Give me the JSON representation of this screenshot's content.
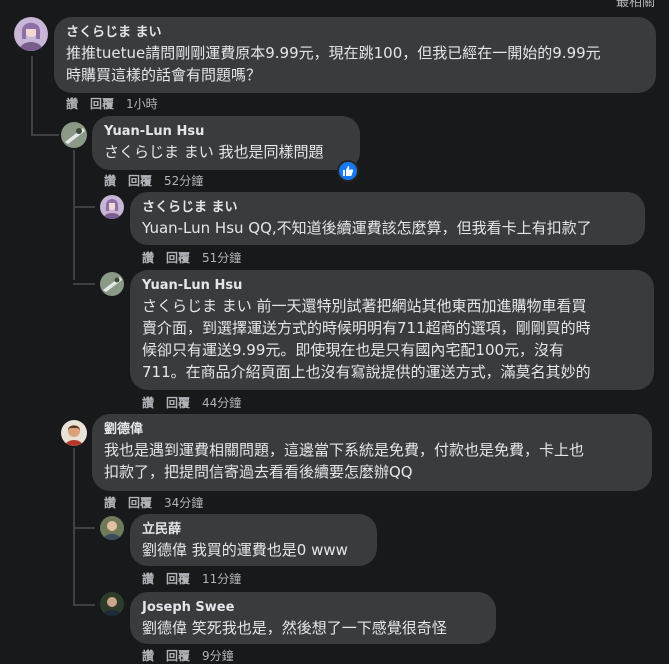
{
  "header": {
    "top_right_label": "最相關"
  },
  "actions": {
    "like": "讚",
    "reply": "回覆"
  },
  "comments": [
    {
      "author": "さくらじま まい",
      "lines": [
        "推推tuetue請問剛剛運費原本9.99元，現在跳100，但我已經在一開始的9.99元",
        "時購買這樣的話會有問題嗎？"
      ],
      "time": "1小時"
    },
    {
      "author": "Yuan-Lun Hsu",
      "lines": [
        "さくらじま まい 我也是同樣問題"
      ],
      "time": "52分鐘"
    },
    {
      "author": "さくらじま まい",
      "lines": [
        "Yuan-Lun Hsu QQ,不知道後續運費該怎麼算，但我看卡上有扣款了"
      ],
      "time": "51分鐘"
    },
    {
      "author": "Yuan-Lun Hsu",
      "lines": [
        "さくらじま まい 前一天還特別試著把網站其他東西加進購物車看買",
        "賣介面，到選擇運送方式的時候明明有711超商的選項，剛剛買的時",
        "候卻只有運送9.99元。即使現在也是只有國內宅配100元，沒有",
        "711。在商品介紹頁面上也沒有寫說提供的運送方式，滿莫名其妙的"
      ],
      "time": "44分鐘"
    },
    {
      "author": "劉德偉",
      "lines": [
        "我也是遇到運費相關問題，這邊當下系統是免費，付款也是免費，卡上也",
        "扣款了，把提問信寄過去看看後續要怎麼辦QQ"
      ],
      "time": "34分鐘"
    },
    {
      "author": "立民薛",
      "lines": [
        "劉德偉 我買的運費也是0 www"
      ],
      "time": "11分鐘"
    },
    {
      "author": "Joseph Swee",
      "lines": [
        "劉德偉 笑死我也是，然後想了一下感覺很奇怪"
      ],
      "time": "9分鐘"
    }
  ],
  "colors": {
    "background": "#18191a",
    "bubble": "#3a3b3c",
    "meta_text": "#b0b3b8",
    "like_blue": "#1877f2"
  }
}
